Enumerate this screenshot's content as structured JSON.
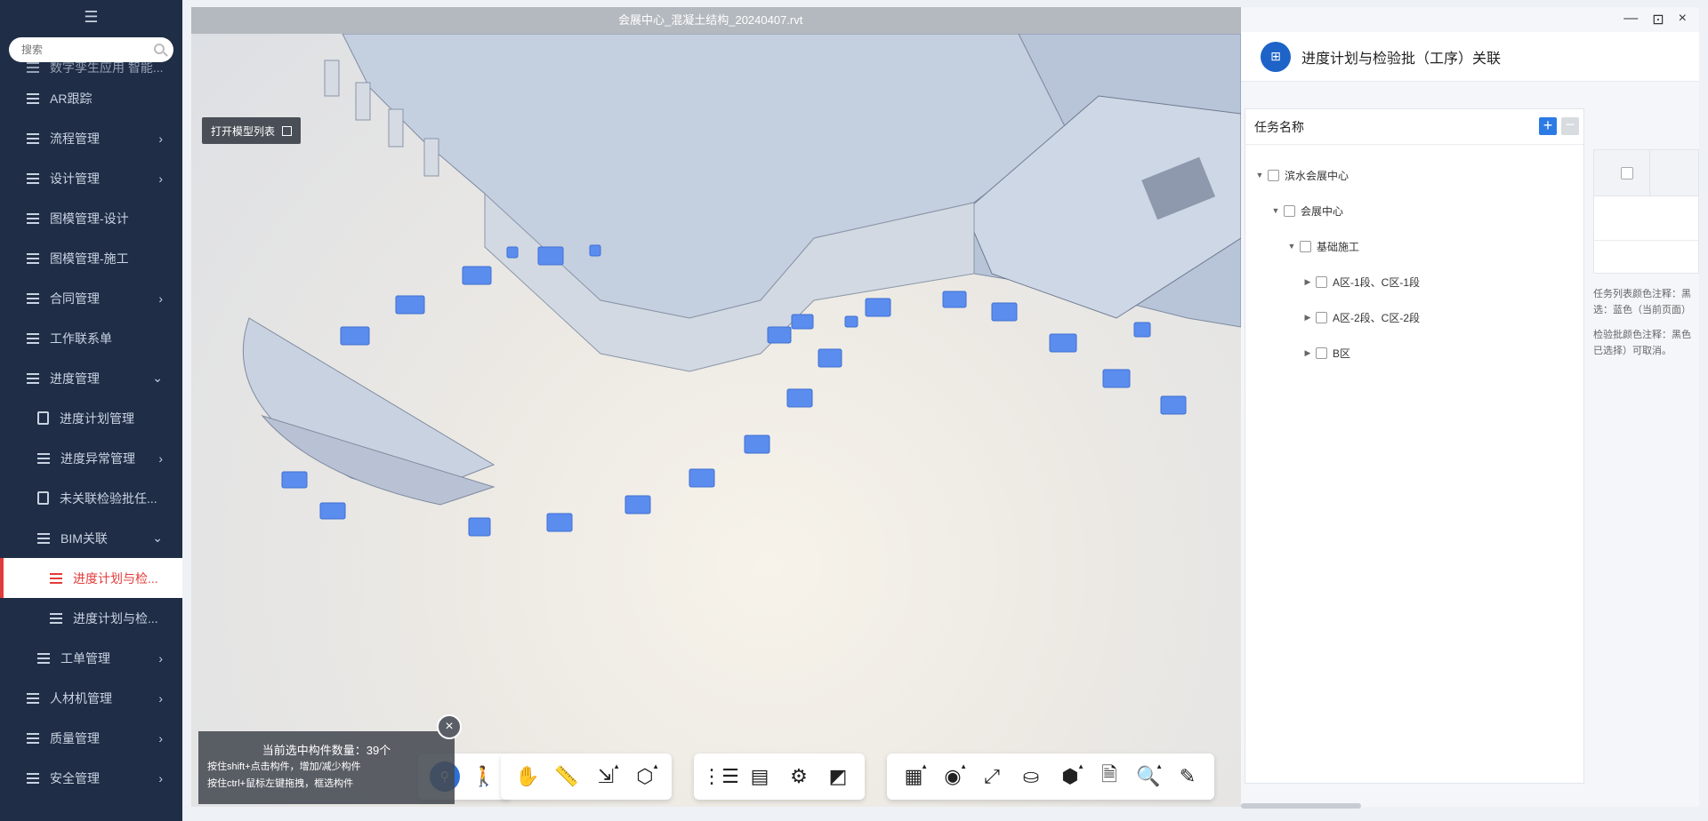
{
  "sidebar": {
    "collapse_icon": "menu-fold-icon",
    "search_placeholder": "搜索",
    "partial_item": "数字孪生应用 智能...",
    "items": [
      {
        "label": "AR跟踪",
        "arrow": ""
      },
      {
        "label": "流程管理",
        "arrow": "›"
      },
      {
        "label": "设计管理",
        "arrow": "›"
      },
      {
        "label": "图模管理-设计",
        "arrow": ""
      },
      {
        "label": "图模管理-施工",
        "arrow": ""
      },
      {
        "label": "合同管理",
        "arrow": "›"
      },
      {
        "label": "工作联系单",
        "arrow": ""
      },
      {
        "label": "进度管理",
        "arrow": "⌄"
      },
      {
        "label": "进度计划管理",
        "arrow": ""
      },
      {
        "label": "进度异常管理",
        "arrow": "›"
      },
      {
        "label": "未关联检验批任...",
        "arrow": ""
      },
      {
        "label": "BIM关联",
        "arrow": "⌄"
      },
      {
        "label": "进度计划与检...",
        "arrow": ""
      },
      {
        "label": "进度计划与检...",
        "arrow": ""
      },
      {
        "label": "工单管理",
        "arrow": "›"
      },
      {
        "label": "人材机管理",
        "arrow": "›"
      },
      {
        "label": "质量管理",
        "arrow": "›"
      },
      {
        "label": "安全管理",
        "arrow": "›"
      }
    ]
  },
  "viewport": {
    "file_title": "会展中心_混凝土结构_20240407.rvt",
    "model_list_label": "打开模型列表",
    "selection_count_line": "当前选中构件数量：39个",
    "hint_line_1": "按住shift+点击构件，增加/减少构件",
    "hint_line_2": "按住ctrl+鼠标左键拖拽，框选构件",
    "close_label": "×"
  },
  "panel": {
    "window_min": "—",
    "window_max": "⊡",
    "window_close": "×",
    "title": "进度计划与检验批（工序）关联",
    "logo_text": "⊞",
    "task_header": "任务名称",
    "add_label": "+",
    "remove_label": "−",
    "tree": [
      {
        "label": "滨水会展中心",
        "caret": "▼"
      },
      {
        "label": "会展中心",
        "caret": "▼"
      },
      {
        "label": "基础施工",
        "caret": "▼"
      },
      {
        "label": "A区-1段、C区-1段",
        "caret": "▶"
      },
      {
        "label": "A区-2段、C区-2段",
        "caret": "▶"
      },
      {
        "label": "B区",
        "caret": "▶"
      }
    ],
    "legend_task": "任务列表颜色注释：黑",
    "legend_task_2": "选：蓝色（当前页面）",
    "legend_batch": "检验批颜色注释：黑色",
    "legend_batch_2": "已选择）可取消。"
  },
  "colors": {
    "sidebar_bg": "#1f2d46",
    "active_red": "#e23b3b",
    "accent_blue": "#2c7be5",
    "component_blue": "#5b8def"
  }
}
